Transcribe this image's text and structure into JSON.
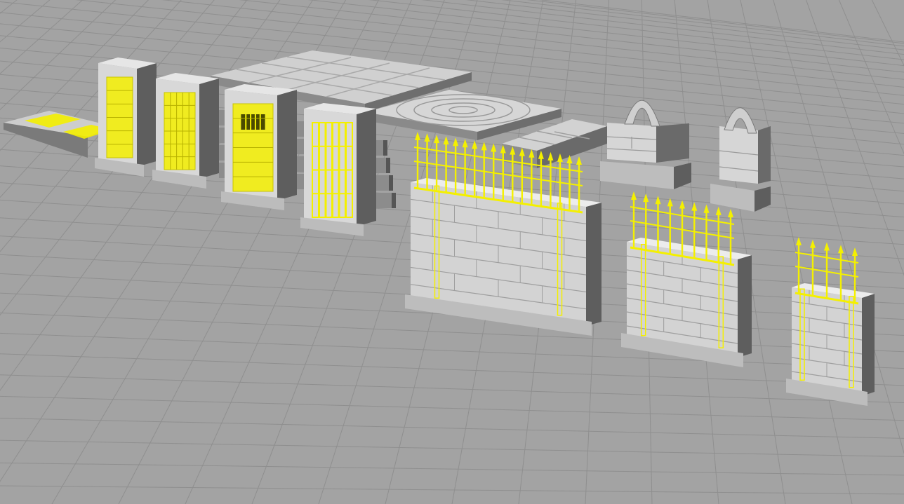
{
  "viewport": {
    "label": "",
    "background_color": "#a3a3a3",
    "grid_color": "#8f8f8f",
    "stone_light": "#dcdcdc",
    "stone_mid": "#c2c2c2",
    "stone_dark": "#5e5e5e",
    "selection_color": "#f4f000"
  },
  "scene": {
    "objects": [
      {
        "name": "floor-tile-with-grate",
        "kind": "floor",
        "selected": true
      },
      {
        "name": "door-wall-solid",
        "kind": "door-wall",
        "selected": true
      },
      {
        "name": "door-wall-planked",
        "kind": "door-wall",
        "selected": true
      },
      {
        "name": "door-wall-barred-window",
        "kind": "door-wall",
        "selected": true
      },
      {
        "name": "door-wall-portcullis",
        "kind": "door-wall",
        "selected": true
      },
      {
        "name": "floor-tile-large-grid",
        "kind": "floor",
        "selected": false
      },
      {
        "name": "floor-tile-rune-circle",
        "kind": "floor",
        "selected": false
      },
      {
        "name": "floor-tile-small",
        "kind": "floor",
        "selected": false
      },
      {
        "name": "wall-window-arch-wide",
        "kind": "wall",
        "selected": false
      },
      {
        "name": "wall-window-arch-narrow",
        "kind": "wall",
        "selected": false
      },
      {
        "name": "fence-wall-long",
        "kind": "fence-wall",
        "selected": true
      },
      {
        "name": "fence-wall-medium",
        "kind": "fence-wall",
        "selected": true
      },
      {
        "name": "fence-wall-short",
        "kind": "fence-wall",
        "selected": true
      }
    ]
  }
}
